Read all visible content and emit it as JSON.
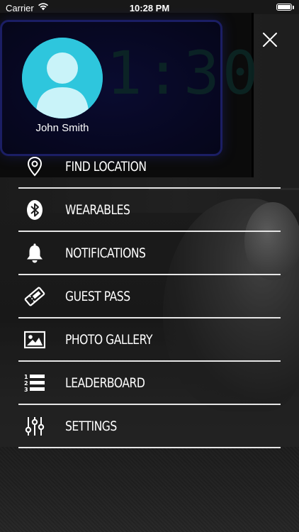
{
  "status_bar": {
    "carrier": "Carrier",
    "time": "10:28 PM",
    "wifi_icon": "wifi-icon",
    "battery_icon": "battery-icon"
  },
  "background": {
    "clock_display": "1:30"
  },
  "drawer": {
    "close_icon": "close-icon",
    "user": {
      "name": "John Smith",
      "avatar_icon": "user-avatar-icon",
      "avatar_color": "#2ec6dd"
    },
    "menu": [
      {
        "label": "FIND LOCATION",
        "icon": "location-pin-icon"
      },
      {
        "label": "WEARABLES",
        "icon": "bluetooth-icon"
      },
      {
        "label": "NOTIFICATIONS",
        "icon": "bell-icon"
      },
      {
        "label": "GUEST PASS",
        "icon": "ticket-icon"
      },
      {
        "label": "PHOTO GALLERY",
        "icon": "photo-icon"
      },
      {
        "label": "LEADERBOARD",
        "icon": "numbered-list-icon"
      },
      {
        "label": "SETTINGS",
        "icon": "sliders-icon"
      }
    ]
  }
}
